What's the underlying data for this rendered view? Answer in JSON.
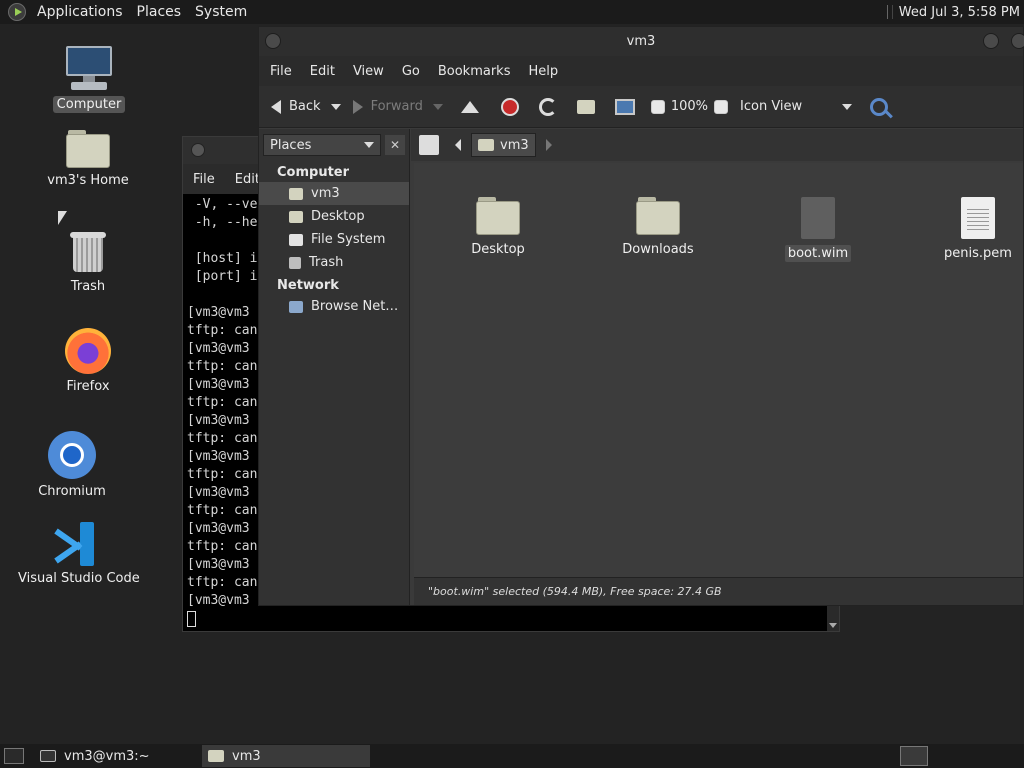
{
  "top_panel": {
    "menus": [
      "Applications",
      "Places",
      "System"
    ],
    "clock": "Wed Jul  3,  5:58 PM"
  },
  "desktop": {
    "icons": [
      {
        "label": "Computer",
        "icon": "monitor-icon",
        "selected": true
      },
      {
        "label": "vm3's Home",
        "icon": "home-folder-icon"
      },
      {
        "label": "Trash",
        "icon": "trash-icon"
      },
      {
        "label": "Firefox",
        "icon": "firefox-icon"
      },
      {
        "label": "Chromium",
        "icon": "chromium-icon"
      },
      {
        "label": "Visual Studio Code",
        "icon": "vscode-icon"
      }
    ]
  },
  "terminal": {
    "menu": [
      "File",
      "Edit"
    ],
    "lines": [
      " -V, --ve",
      " -h, --he",
      "",
      " [host] i",
      " [port] i",
      "",
      "[vm3@vm3",
      "tftp: can",
      "[vm3@vm3",
      "tftp: can",
      "[vm3@vm3",
      "tftp: can",
      "[vm3@vm3",
      "tftp: can",
      "[vm3@vm3",
      "tftp: can",
      "[vm3@vm3",
      "tftp: can",
      "[vm3@vm3",
      "tftp: can",
      "[vm3@vm3",
      "tftp: can",
      "[vm3@vm3"
    ]
  },
  "file_manager": {
    "title": "vm3",
    "menu": [
      "File",
      "Edit",
      "View",
      "Go",
      "Bookmarks",
      "Help"
    ],
    "toolbar": {
      "back": "Back",
      "forward": "Forward",
      "zoom": "100%",
      "view_mode": "Icon View"
    },
    "sidebar": {
      "selector": "Places",
      "close": "✕",
      "groups": [
        {
          "title": "Computer",
          "items": [
            {
              "label": "vm3",
              "selected": true
            },
            {
              "label": "Desktop"
            },
            {
              "label": "File System"
            },
            {
              "label": "Trash"
            }
          ]
        },
        {
          "title": "Network",
          "items": [
            {
              "label": "Browse Net…"
            }
          ]
        }
      ]
    },
    "location": {
      "crumb": "vm3"
    },
    "files": [
      {
        "name": "Desktop",
        "icon": "folder-icon"
      },
      {
        "name": "Downloads",
        "icon": "folder-icon"
      },
      {
        "name": "boot.wim",
        "icon": "file-icon",
        "selected": true
      },
      {
        "name": "penis.pem",
        "icon": "text-file-icon"
      }
    ],
    "status": "\"boot.wim\" selected (594.4 MB), Free space: 27.4 GB"
  },
  "bottom_panel": {
    "tasks": [
      {
        "label": "vm3@vm3:~",
        "active": false
      },
      {
        "label": "vm3",
        "active": true
      }
    ]
  }
}
